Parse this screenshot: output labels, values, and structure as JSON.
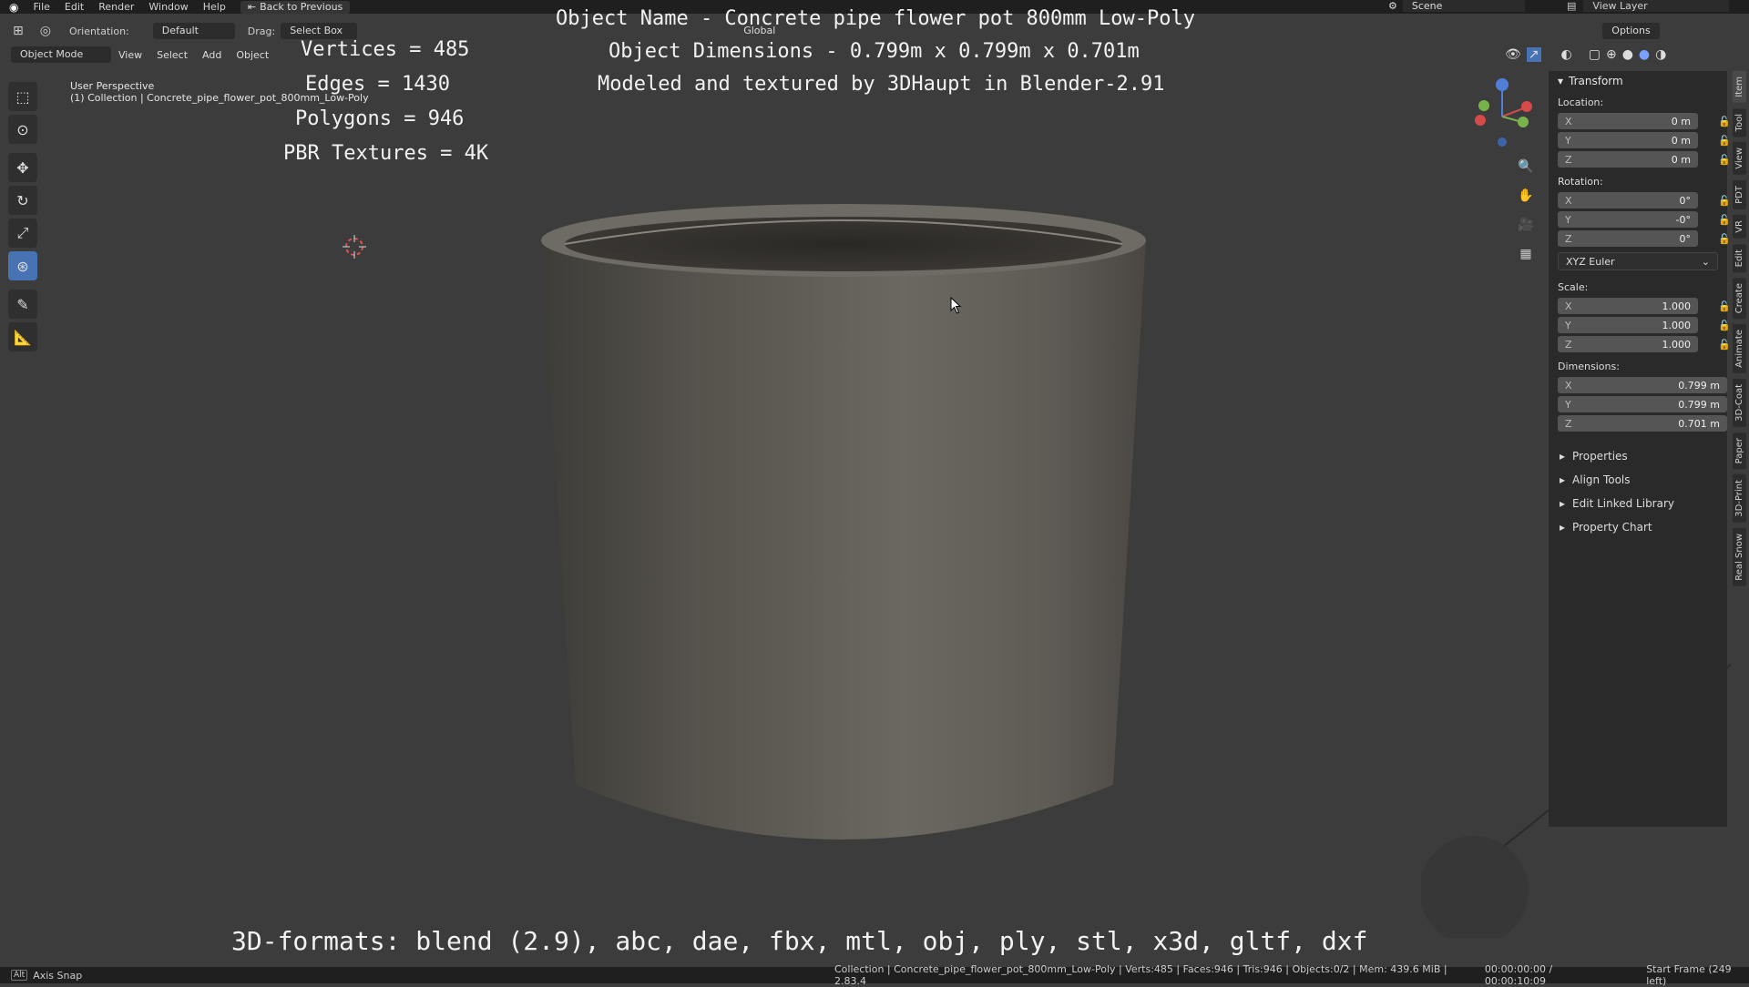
{
  "menubar": {
    "items": [
      "File",
      "Edit",
      "Render",
      "Window",
      "Help"
    ],
    "back_button": "Back to Previous",
    "scene_label": "Scene",
    "view_layer_label": "View Layer"
  },
  "header": {
    "orientation_label": "Orientation:",
    "orientation_value": "Default",
    "drag_label": "Drag:",
    "drag_value": "Select Box",
    "transform_orientation": "Global",
    "options_label": "Options",
    "mode": "Object Mode",
    "menus": [
      "View",
      "Select",
      "Add",
      "Object"
    ]
  },
  "viewport": {
    "perspective": "User Perspective",
    "collection_line": "(1) Collection | Concrete_pipe_flower_pot_800mm_Low-Poly"
  },
  "overlay": {
    "object_name": "Object Name - Concrete pipe flower pot 800mm Low-Poly",
    "object_dimensions": "Object Dimensions -  0.799m x 0.799m x 0.701m",
    "credit": "Modeled and textured by 3DHaupt in Blender-2.91",
    "vertices": "Vertices = 485",
    "edges": "Edges = 1430",
    "polygons": "Polygons = 946",
    "textures": "PBR Textures = 4K",
    "formats": "3D-formats: blend (2.9), abc, dae, fbx, mtl, obj, ply, stl, x3d, gltf, dxf"
  },
  "npanel": {
    "title": "Transform",
    "location_label": "Location:",
    "location": [
      {
        "axis": "X",
        "value": "0 m"
      },
      {
        "axis": "Y",
        "value": "0 m"
      },
      {
        "axis": "Z",
        "value": "0 m"
      }
    ],
    "rotation_label": "Rotation:",
    "rotation": [
      {
        "axis": "X",
        "value": "0°"
      },
      {
        "axis": "Y",
        "value": "-0°"
      },
      {
        "axis": "Z",
        "value": "0°"
      }
    ],
    "rotation_mode": "XYZ Euler",
    "scale_label": "Scale:",
    "scale": [
      {
        "axis": "X",
        "value": "1.000"
      },
      {
        "axis": "Y",
        "value": "1.000"
      },
      {
        "axis": "Z",
        "value": "1.000"
      }
    ],
    "dimensions_label": "Dimensions:",
    "dimensions": [
      {
        "axis": "X",
        "value": "0.799 m"
      },
      {
        "axis": "Y",
        "value": "0.799 m"
      },
      {
        "axis": "Z",
        "value": "0.701 m"
      }
    ],
    "collapsed_sections": [
      "Properties",
      "Align Tools",
      "Edit Linked Library",
      "Property Chart"
    ],
    "side_tabs": [
      "Item",
      "Tool",
      "View",
      "PDT",
      "VR",
      "Edit",
      "Create",
      "Animate",
      "3D-Coat",
      "Paper",
      "3D-Print",
      "Real Snow"
    ]
  },
  "statusbar": {
    "key": "Alt",
    "left": "Axis Snap",
    "stats": "Collection | Concrete_pipe_flower_pot_800mm_Low-Poly | Verts:485 | Faces:946 | Tris:946 | Objects:0/2 | Mem: 439.6 MiB | 2.83.4",
    "time": "00:00:00:00 / 00:00:10:09",
    "frame": "Start Frame (249 left)"
  }
}
